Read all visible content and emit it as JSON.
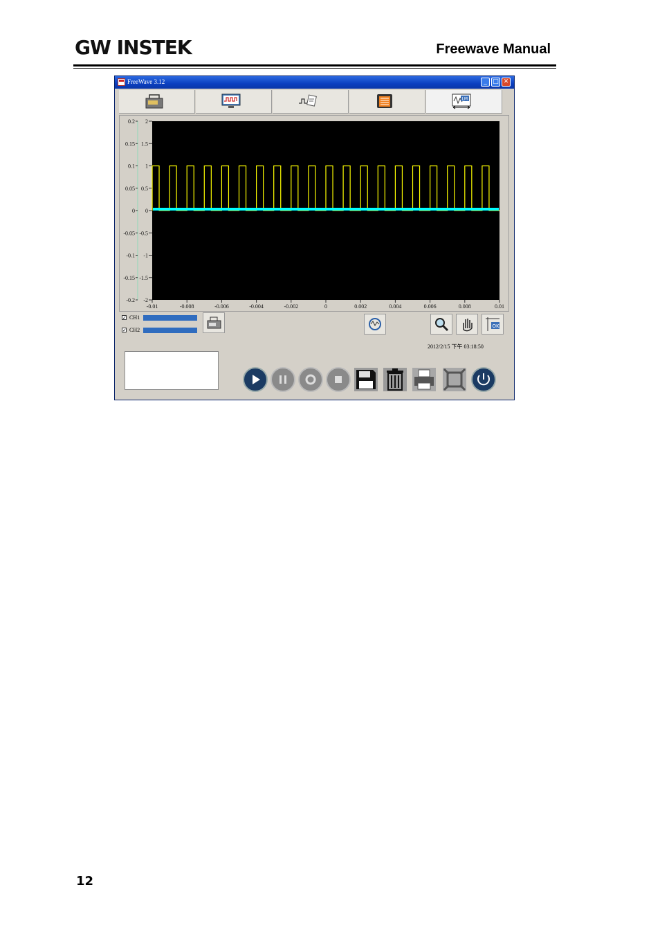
{
  "page": {
    "brand": "GW INSTEK",
    "manual_title": "Freewave Manual",
    "page_number": "12"
  },
  "window": {
    "title": "FreeWave 3.12",
    "buttons": {
      "minimize": "_",
      "maximize": "□",
      "close": "✕"
    },
    "toolbar": [
      {
        "name": "connection",
        "icon": "plug-icon"
      },
      {
        "name": "waveform",
        "icon": "monitor-wave-icon"
      },
      {
        "name": "signal-analysis",
        "icon": "wave-analysis-icon"
      },
      {
        "name": "data-list",
        "icon": "clipboard-icon"
      },
      {
        "name": "measure",
        "icon": "lm-measure-icon"
      }
    ],
    "timestamp": "2012/2/15 下午 03:18:50",
    "channels": [
      {
        "label": "CH1",
        "checked": true,
        "check": "✓",
        "color": "#2f6cbf"
      },
      {
        "label": "CH2",
        "checked": true,
        "check": "✓",
        "color": "#2f6cbf"
      }
    ],
    "controls": [
      "play",
      "pause",
      "record",
      "stop",
      "save",
      "delete",
      "print",
      "fullscreen",
      "power"
    ]
  },
  "chart_data": {
    "type": "line",
    "background": "#000000",
    "x": {
      "range": [
        -0.01,
        0.01
      ],
      "ticks": [
        "-0.01",
        "-0.008",
        "-0.006",
        "-0.004",
        "-0.002",
        "0",
        "0.002",
        "0.004",
        "0.006",
        "0.008",
        "0.01"
      ]
    },
    "y_left": {
      "range": [
        -0.2,
        0.2
      ],
      "ticks": [
        "0.2",
        "0.15",
        "0.1",
        "0.05",
        "0",
        "-0.05",
        "-0.1",
        "-0.15",
        "-0.2"
      ]
    },
    "y_right": {
      "range": [
        -2,
        2
      ],
      "ticks": [
        "2",
        "1.5",
        "1",
        "0.5",
        "0",
        "-0.5",
        "-1",
        "-1.5",
        "-2"
      ]
    },
    "series": [
      {
        "channel": "CH1",
        "color": "#ffff00",
        "kind": "square-wave",
        "low": 0,
        "high": 1,
        "period": 0.001,
        "duty": 0.4,
        "x_start": -0.01,
        "x_end": 0.01
      },
      {
        "channel": "CH2",
        "color": "#00ffff",
        "kind": "constant",
        "level": 0
      }
    ]
  }
}
